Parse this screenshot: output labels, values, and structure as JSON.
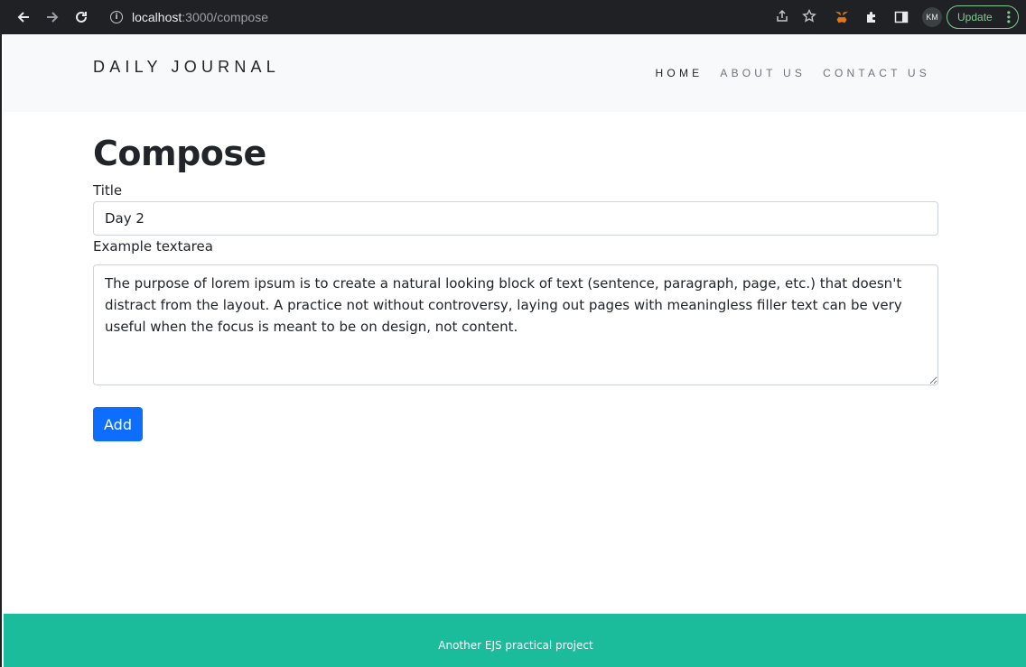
{
  "browser": {
    "url_host": "localhost",
    "url_path": ":3000/compose",
    "avatar_initials": "KM",
    "update_label": "Update"
  },
  "site": {
    "brand": "DAILY JOURNAL",
    "nav": [
      {
        "label": "HOME",
        "active": true
      },
      {
        "label": "ABOUT US",
        "active": false
      },
      {
        "label": "CONTACT US",
        "active": false
      }
    ]
  },
  "compose": {
    "heading": "Compose",
    "title_label": "Title",
    "title_value": "Day 2",
    "textarea_label": "Example textarea",
    "textarea_value": "The purpose of lorem ipsum is to create a natural looking block of text (sentence, paragraph, page, etc.) that doesn't distract from the layout. A practice not without controversy, laying out pages with meaningless filler text can be very useful when the focus is meant to be on design, not content.",
    "add_label": "Add"
  },
  "footer": {
    "text": "Another EJS practical project"
  },
  "colors": {
    "footer_bg": "#1abc9c",
    "button_primary": "#0d6efd",
    "header_bg": "#f8f9fa"
  }
}
